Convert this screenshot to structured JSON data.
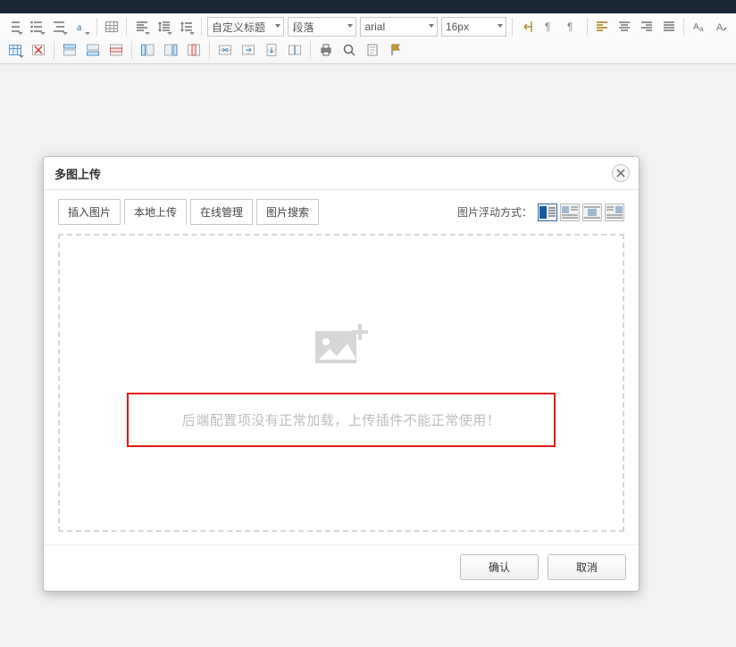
{
  "toolbar": {
    "heading_style": "自定义标题",
    "paragraph": "段落",
    "font_family": "arial",
    "font_size": "16px"
  },
  "dialog": {
    "title": "多图上传",
    "tabs": [
      "插入图片",
      "本地上传",
      "在线管理",
      "图片搜索"
    ],
    "active_tab": 1,
    "float_label": "图片浮动方式：",
    "error_message": "后端配置项没有正常加载，上传插件不能正常使用！",
    "ok": "确认",
    "cancel": "取消"
  }
}
